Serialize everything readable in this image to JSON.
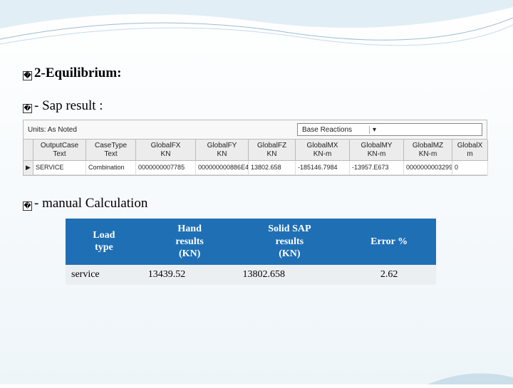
{
  "glyph": "�",
  "headings": {
    "title": "2-Equilibrium:",
    "sap": "- Sap result  :",
    "manual": "- manual Calculation"
  },
  "sap": {
    "unitsLabel": "Units: As Noted",
    "dropdownLabel": "Base Reactions",
    "columns": [
      {
        "l1": "",
        "l2": ""
      },
      {
        "l1": "OutputCase",
        "l2": "Text"
      },
      {
        "l1": "CaseType",
        "l2": "Text"
      },
      {
        "l1": "GlobalFX",
        "l2": "KN"
      },
      {
        "l1": "GlobalFY",
        "l2": "KN"
      },
      {
        "l1": "GlobalFZ",
        "l2": "KN"
      },
      {
        "l1": "GlobalMX",
        "l2": "KN-m"
      },
      {
        "l1": "GlobalMY",
        "l2": "KN-m"
      },
      {
        "l1": "GlobalMZ",
        "l2": "KN-m"
      },
      {
        "l1": "GlobalX",
        "l2": "m"
      }
    ],
    "row": {
      "handle": "▶",
      "outputCase": "SERVICE",
      "caseType": "Combination",
      "fx": "0000000007785",
      "fy": "000000000886E4",
      "fz": "13802.658",
      "mx": "-185146.7984",
      "my": "-13957.E673",
      "mz": "0000000003299",
      "x": "0"
    }
  },
  "comparison": {
    "headers": {
      "loadType": {
        "l1": "Load",
        "l2": "type"
      },
      "hand": {
        "l1": "Hand",
        "l2": "results",
        "l3": "(KN)"
      },
      "sap": {
        "l1": "Solid SAP",
        "l2": "results",
        "l3": "(KN)"
      },
      "error": {
        "l1": "Error  %"
      }
    },
    "rows": [
      {
        "load": "service",
        "hand": "13439.52",
        "sap": "13802.658",
        "error": "2.62"
      }
    ]
  }
}
